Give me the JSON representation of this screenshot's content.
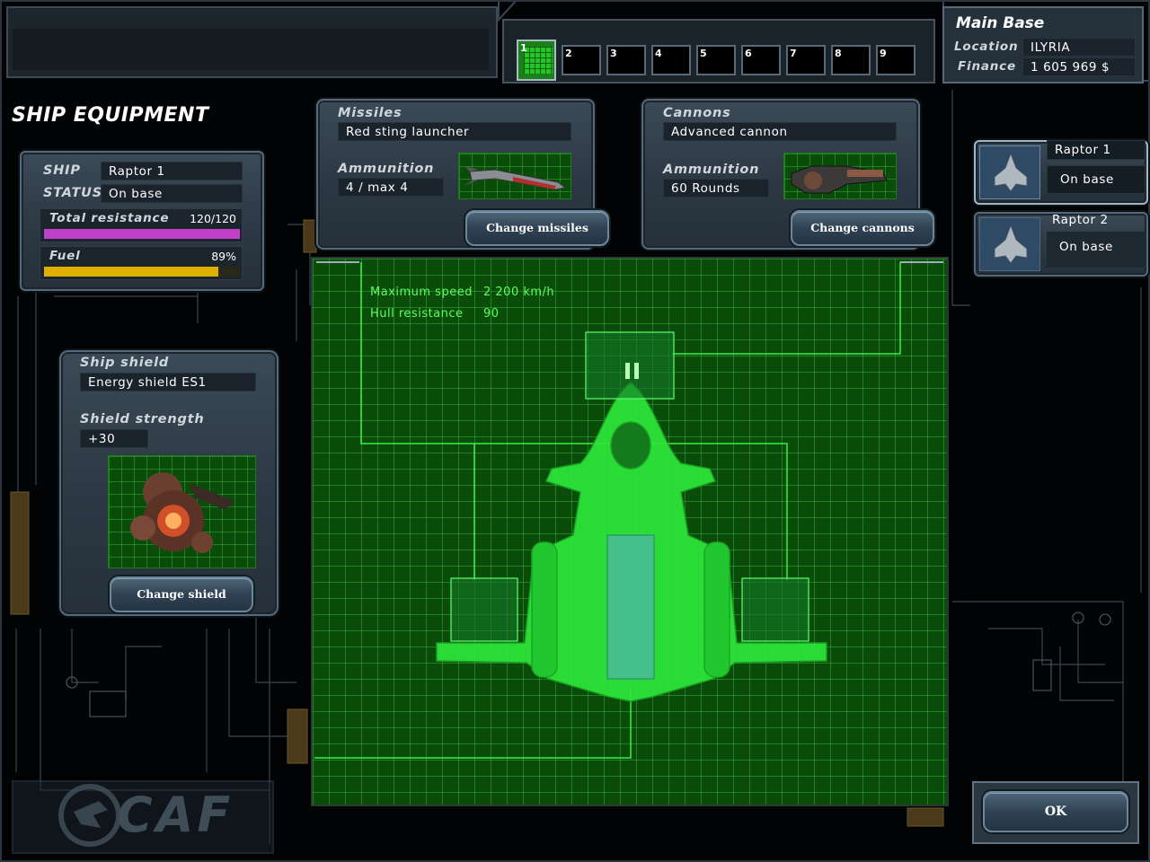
{
  "page_title": "SHIP EQUIPMENT",
  "base": {
    "name": "Main Base",
    "location_label": "Location",
    "location_value": "ILYRIA",
    "finance_label": "Finance",
    "finance_value": "1 605 969 $"
  },
  "slots": [
    "1",
    "2",
    "3",
    "4",
    "5",
    "6",
    "7",
    "8",
    "9"
  ],
  "ship_info": {
    "ship_label": "SHIP",
    "ship_value": "Raptor 1",
    "status_label": "STATUS",
    "status_value": "On base",
    "resistance_label": "Total resistance",
    "resistance_value": "120/120",
    "resistance_fraction": 1.0,
    "fuel_label": "Fuel",
    "fuel_value": "89%",
    "fuel_fraction": 0.89
  },
  "missiles": {
    "title": "Missiles",
    "name": "Red sting launcher",
    "ammo_label": "Ammunition",
    "ammo_value": "4 / max 4",
    "button": "Change missiles"
  },
  "cannons": {
    "title": "Cannons",
    "name": "Advanced cannon",
    "ammo_label": "Ammunition",
    "ammo_value": "60 Rounds",
    "button": "Change cannons"
  },
  "shield": {
    "title": "Ship shield",
    "name": "Energy shield ES1",
    "strength_label": "Shield strength",
    "strength_value": "+30",
    "button": "Change shield"
  },
  "stats": {
    "speed_label": "Maximum speed",
    "speed_value": "2 200 km/h",
    "hull_label": "Hull resistance",
    "hull_value": "90"
  },
  "fleet": [
    {
      "name": "Raptor 1",
      "status": "On base"
    },
    {
      "name": "Raptor 2",
      "status": "On base"
    }
  ],
  "ok_button": "OK",
  "logo_text": "CAF",
  "colors": {
    "resistance_bar": "#c040c8",
    "fuel_bar": "#e0b000",
    "ship_hologram": "#2de83a",
    "grid": "#0a4d0a"
  }
}
